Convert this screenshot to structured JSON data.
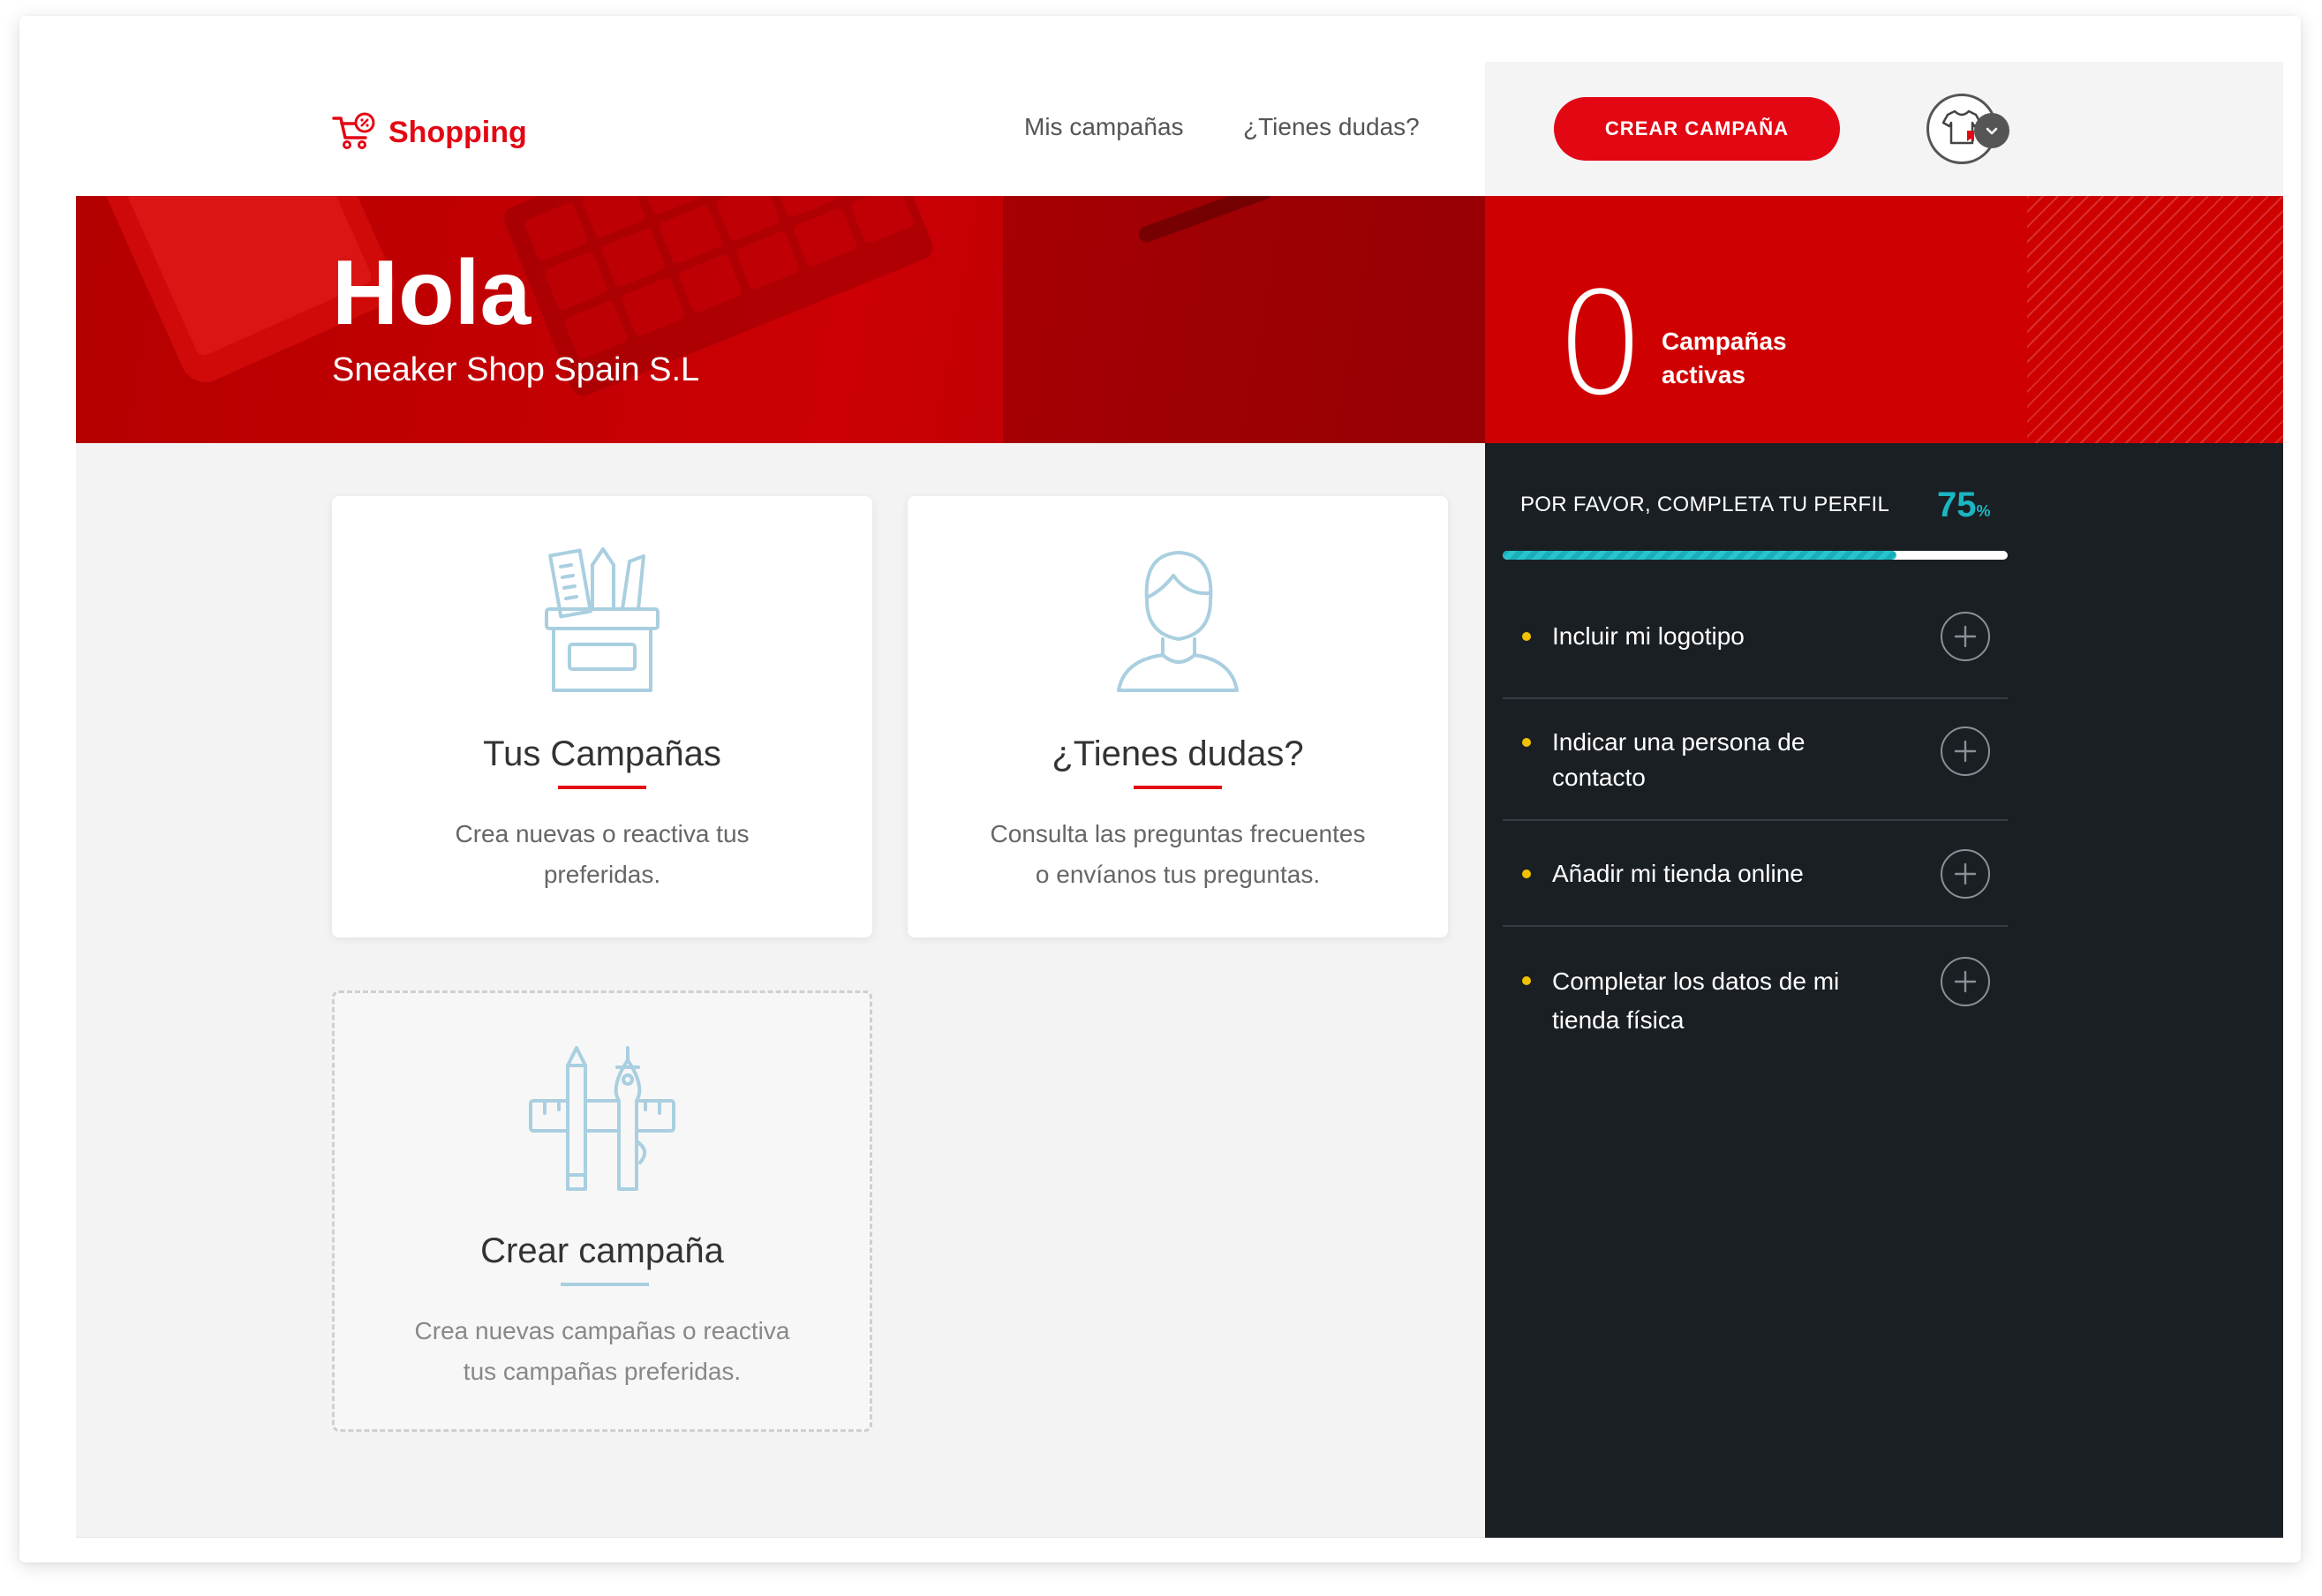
{
  "brand": {
    "name": "Shopping",
    "accent": "#e30613"
  },
  "nav": {
    "links": [
      "Mis campañas",
      "¿Tienes dudas?"
    ],
    "cta_label": "CREAR CAMPAÑA"
  },
  "hero": {
    "greeting": "Hola",
    "company": "Sneaker Shop Spain S.L"
  },
  "stats": {
    "active_count": "0",
    "label_line1": "Campañas",
    "label_line2": "activas"
  },
  "cards": [
    {
      "icon": "stationery-cup-icon",
      "title": "Tus Campañas",
      "desc_line1": "Crea nuevas o reactiva tus",
      "desc_line2": "preferidas."
    },
    {
      "icon": "user-icon",
      "title": "¿Tienes dudas?",
      "desc_line1": "Consulta las preguntas frecuentes",
      "desc_line2": "o envíanos tus preguntas."
    },
    {
      "icon": "pen-ruler-icon",
      "title": "Crear campaña",
      "desc_line1": "Crea nuevas campañas o reactiva",
      "desc_line2": "tus campañas preferidas."
    }
  ],
  "profile": {
    "title": "POR FAVOR, COMPLETA TU PERFIL",
    "percent": "75",
    "percent_sign": "%",
    "progress": 0.78,
    "progress_color": "#1ab6c2",
    "tasks": [
      {
        "line1": "Incluir mi logotipo",
        "line2": ""
      },
      {
        "line1": "Indicar una persona de",
        "line2": "contacto"
      },
      {
        "line1": "Añadir mi tienda online",
        "line2": ""
      },
      {
        "line1": "Completar los datos de mi",
        "line2": "tienda física"
      }
    ]
  }
}
